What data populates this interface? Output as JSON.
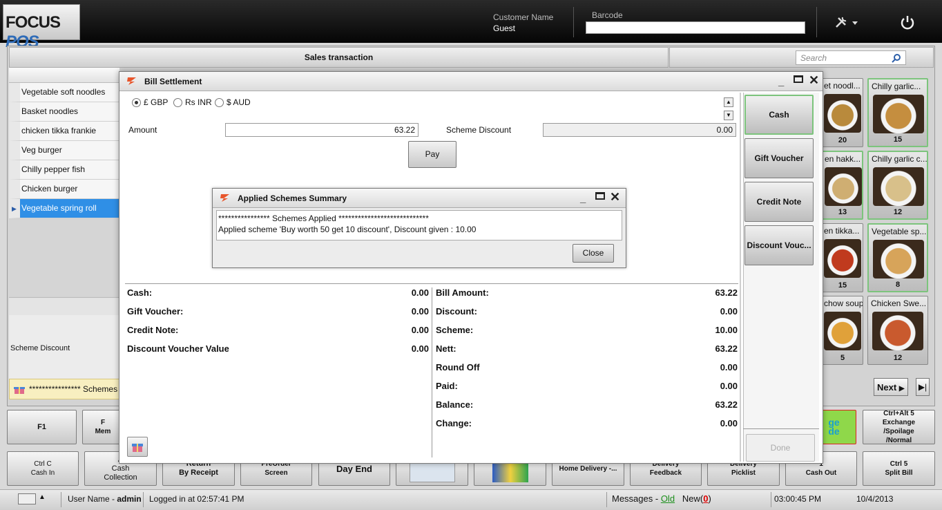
{
  "header": {
    "logo_focus": "FOCUS",
    "logo_pos": "POS",
    "customer_label": "Customer Name",
    "customer_value": "Guest",
    "barcode_label": "Barcode",
    "tools_icon": "tools-icon",
    "power_icon": "power-icon"
  },
  "sales": {
    "header": "Sales transaction",
    "items": [
      "Vegetable soft noodles",
      "Basket noodles",
      "chicken tikka frankie",
      "Veg burger",
      "Chilly pepper fish",
      "Chicken burger",
      "Vegetable spring roll"
    ],
    "selected_index": 6,
    "scheme_discount_label": "Scheme Discount",
    "scheme_message": "**************** Schemes"
  },
  "search": {
    "placeholder": "Search"
  },
  "tiles": [
    {
      "title": "et noodl...",
      "qty": "20",
      "color": "#b98a3c"
    },
    {
      "title": "Chilly garlic...",
      "qty": "15",
      "color": "#c58e3f"
    },
    {
      "title": "en hakk...",
      "qty": "13",
      "color": "#cfae72"
    },
    {
      "title": "Chilly garlic c...",
      "qty": "12",
      "color": "#d8c08a"
    },
    {
      "title": "en tikka...",
      "qty": "15",
      "color": "#c03a1e"
    },
    {
      "title": "Vegetable sp...",
      "qty": "8",
      "color": "#d7a45a"
    },
    {
      "title": "chow soup",
      "qty": "5",
      "color": "#e0a13a"
    },
    {
      "title": "Chicken Swe...",
      "qty": "12",
      "color": "#c95a2e"
    }
  ],
  "pager": {
    "next": "Next",
    "last_icon": "last-page-icon"
  },
  "bottom_buttons": {
    "f1": "F1",
    "row1_b2": "F\nMem",
    "exchange_partial": "ge\nde",
    "ctrl_alt5": "Ctrl+Alt 5\nExchange\n/Spoilage\n/Normal",
    "ctrl_c": "Ctrl C\nCash In",
    "cash_collection": "A\nCash\nCollection",
    "return_receipt": "Return\nBy Receipt",
    "preorder": "PreOrder\nScreen",
    "day_end": "Day End",
    "home_delivery": "Home Delivery -...",
    "delivery_feedback": "Delivery\nFeedback",
    "delivery_picklist": "Delivery\nPicklist",
    "cash_out": "1\nCash Out",
    "split_bill": "Ctrl 5\nSplit Bill"
  },
  "status": {
    "user_label": "User Name - ",
    "user_value": "admin",
    "login": "Logged in at 02:57:41 PM",
    "messages": "Messages - ",
    "old": "Old",
    "new_label": "New(",
    "new_count": "0",
    "new_close": ")",
    "time": "03:00:45 PM",
    "date": "10/4/2013"
  },
  "bill": {
    "title": "Bill Settlement",
    "currencies": [
      {
        "label": "£ GBP",
        "selected": true
      },
      {
        "label": "Rs INR",
        "selected": false
      },
      {
        "label": "$ AUD",
        "selected": false
      }
    ],
    "amount_label": "Amount",
    "amount_value": "63.22",
    "scheme_discount_label": "Scheme Discount",
    "scheme_discount_value": "0.00",
    "pay_label": "Pay",
    "payment_modes": [
      "Cash",
      "Gift Voucher",
      "Credit Note",
      "Discount Vouc..."
    ],
    "done_label": "Done",
    "left_summary": [
      {
        "label": "Cash:",
        "value": "0.00"
      },
      {
        "label": "Gift Voucher:",
        "value": "0.00"
      },
      {
        "label": "Credit Note:",
        "value": "0.00"
      },
      {
        "label": "Discount Voucher Value",
        "value": "0.00"
      }
    ],
    "right_summary": [
      {
        "label": "Bill Amount:",
        "value": "63.22"
      },
      {
        "label": "Discount:",
        "value": "0.00"
      },
      {
        "label": "Scheme:",
        "value": "10.00"
      },
      {
        "label": "Nett:",
        "value": "63.22"
      },
      {
        "label": "Round Off",
        "value": "0.00"
      },
      {
        "label": "Paid:",
        "value": "0.00"
      },
      {
        "label": "Balance:",
        "value": "63.22"
      },
      {
        "label": "Change:",
        "value": "0.00"
      }
    ]
  },
  "schemes_dialog": {
    "title": "Applied Schemes Summary",
    "line1": "**************** Schemes Applied ****************************",
    "line2": "Applied scheme 'Buy worth 50 get 10 discount', Discount given : 10.00",
    "close_label": "Close"
  }
}
